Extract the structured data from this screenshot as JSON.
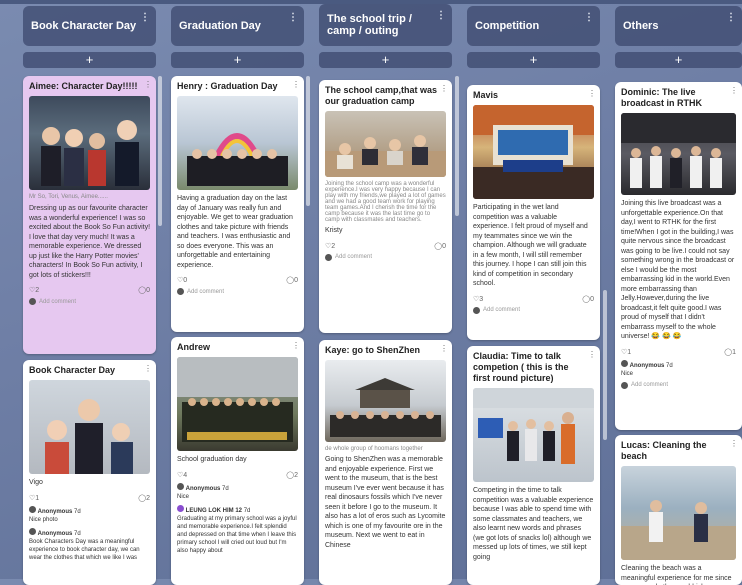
{
  "columns": [
    {
      "title": "Book Character Day",
      "add": "+"
    },
    {
      "title": "Graduation Day",
      "add": "+"
    },
    {
      "title": "The school trip / camp / outing",
      "add": "+"
    },
    {
      "title": "Competition",
      "add": "+"
    },
    {
      "title": "Others",
      "add": "+"
    }
  ],
  "cards": {
    "aimee": {
      "title": "Aimee: Character Day!!!!!",
      "caption": "Mr So, Tori, Venus, Aimee......",
      "body": "Dressing up as our favourite character was a wonderful experience! I was so excited about the Book So Fun activity! I love that day very much! It was a memorable experience. We dressed up just like the Harry Potter movies' characters! In Book So Fun activity, I got lots of stickers!!!",
      "likes": "2",
      "comments": "0",
      "add_comment": "Add comment"
    },
    "book2": {
      "title": "Book Character Day",
      "body": "Vigo",
      "likes": "1",
      "comments": "2",
      "c1_name": "Anonymous",
      "c1_time": "7d",
      "c1_text": "Nice photo",
      "c2_name": "Anonymous",
      "c2_time": "7d",
      "c2_text": "Book Characters Day was a meaningful experience to book character day, we can wear the clothes that which we like I was"
    },
    "henry": {
      "title": "Henry : Graduation Day",
      "body": "Having a graduation day on the last day of January was really fun and enjoyable. We get to wear graduation clothes and take picture with friends and teachers. I was enthusiastic and so does everyone. This was an unforgettable and entertaining experience.",
      "likes": "0",
      "comments": "0",
      "add_comment": "Add comment"
    },
    "andrew": {
      "title": "Andrew",
      "body": "School graduation day",
      "likes": "4",
      "comments": "2",
      "c1_name": "Anonymous",
      "c1_time": "7d",
      "c1_text": "Nice",
      "c2_name": "LEUNG LOK HIM 12",
      "c2_time": "7d",
      "c2_text": "Graduating at my primary school was a joyful and memorable experience.I felt splendid and depressed on that time when I leave this primary school I will cried out loud but I'm also happy about"
    },
    "camp": {
      "title": "The school camp,that was our graduation camp",
      "caption": "Joining the school camp was a wonderful experience.I was very happy because I can play with my friends,we played a lot of games and we had a good team work for playing team games.And I cherish the time for the camp because it was the last time go to camp with classmates and teachers.",
      "body": "Kristy",
      "likes": "2",
      "comments": "0",
      "add_comment": "Add comment"
    },
    "kaye": {
      "title": "Kaye: go to ShenZhen",
      "caption": "de whole group of hoomans together",
      "body": "Going to ShenZhen was a memorable and enjoyable experience. First we went to the museum, that is the best museum I've ever went because it has real dinosaurs fossils which I've never seen it before I go to the museum. It also has a lot of eros such as Lycomite which is one of my favourite ore in the museum. Next we went to eat in Chinese"
    },
    "mavis": {
      "title": "Mavis",
      "body": "Participating in the wet land competition was a valuable experience. I felt proud of myself and my teammates since we win the champion. Although we will graduate in a few month, I will still remember this journey. I hope I can still join this kind of competition in secondary school.",
      "likes": "3",
      "comments": "0",
      "add_comment": "Add comment"
    },
    "claudia": {
      "title": "Claudia: Time to talk competion ( this is the first round picture)",
      "body": "Competing in the time to talk competition was a valuable experience because I was able to spend time with some classmates and teachers, we also learnt new words and phrases (we got lots of snacks lol) although we messed up lots of times, we still kept going"
    },
    "dominic": {
      "title": "Dominic: The live broadcast in RTHK",
      "body": "Joining this live broadcast was a unforgettable experience.On that day,I went to RTHK for the first time!When I got in the building,I was quite nervous since the broadcast was going to be live.I could not say something wrong in the broadcast or else I would be the most embarrassing kid in the world.Even more embarrassing than Jelly.However,during the live broadcast,it felt quite good.I was proud of myself that I didn't embarrass myself to the whole universe! 😂 😂 😂",
      "likes": "1",
      "comments": "1",
      "c1_name": "Anonymous",
      "c1_time": "7d",
      "c1_text": "Nice",
      "add_comment": "Add comment"
    },
    "lucas": {
      "title": "Lucas: Cleaning the beach",
      "body": "Cleaning the beach was a meaningful experience for me since many people threw rubbish"
    }
  },
  "icons": {
    "more": "more-vertical-icon",
    "like": "heart-icon",
    "comment": "comment-icon"
  }
}
